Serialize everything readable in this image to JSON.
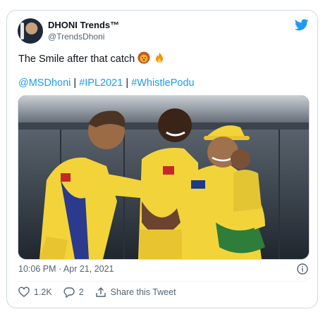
{
  "tweet": {
    "author_name": "DHONI Trends™",
    "author_handle": "@TrendsDhoni",
    "text": "The Smile after that catch",
    "emojis": [
      "lion-emoji",
      "fire-emoji"
    ],
    "hashtags": [
      "@MSDhoni",
      "#IPL2021",
      "#WhistlePodu"
    ],
    "separator": "|",
    "timestamp": "10:06 PM · Apr 21, 2021",
    "likes": "1.2K",
    "replies": "2",
    "share_label": "Share this Tweet"
  },
  "media": {
    "description": "CSK players celebrating in yellow jerseys",
    "jersey_color": "#f2d43a"
  },
  "colors": {
    "link": "#1d9bf0",
    "muted": "#536471",
    "border": "#cfd9de"
  }
}
